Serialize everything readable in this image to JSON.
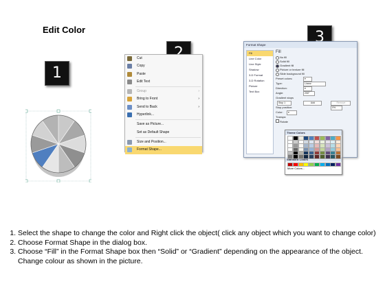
{
  "title": "Edit Color",
  "badges": [
    "1",
    "2",
    "3"
  ],
  "context_menu": {
    "items": [
      {
        "label": "Cut",
        "underline": "t",
        "icon": "scissors-icon",
        "color": "#7a6a3a",
        "disabled": false,
        "submenu": false
      },
      {
        "label": "Copy",
        "icon": "copy-icon",
        "color": "#6b7fa6",
        "disabled": false,
        "submenu": false
      },
      {
        "label": "Paste",
        "icon": "paste-icon",
        "color": "#b08a3a",
        "disabled": false,
        "submenu": false
      },
      {
        "label": "Edit Text",
        "icon": "edit-text-icon",
        "color": "#8a8a8a",
        "disabled": false,
        "submenu": false
      },
      {
        "label": "Group",
        "icon": "group-icon",
        "color": "#b5b5b5",
        "disabled": true,
        "submenu": true
      },
      {
        "label": "Bring to Front",
        "icon": "bring-front-icon",
        "color": "#d6a33a",
        "disabled": false,
        "submenu": true
      },
      {
        "label": "Send to Back",
        "icon": "send-back-icon",
        "color": "#6c8fc6",
        "disabled": false,
        "submenu": true
      },
      {
        "label": "Hyperlink...",
        "icon": "hyperlink-icon",
        "color": "#3a6fb0",
        "disabled": false,
        "submenu": false
      },
      {
        "label": "Save as Picture...",
        "icon": "",
        "color": "",
        "disabled": false,
        "submenu": false
      },
      {
        "label": "Set as Default Shape",
        "icon": "",
        "color": "",
        "disabled": false,
        "submenu": false
      },
      {
        "label": "Size and Position...",
        "icon": "size-position-icon",
        "color": "#8a9ab0",
        "disabled": false,
        "submenu": false
      },
      {
        "label": "Format Shape...",
        "icon": "format-shape-icon",
        "color": "#8ab0d0",
        "disabled": false,
        "submenu": false,
        "highlighted": true
      }
    ]
  },
  "dialog": {
    "title": "Format Shape",
    "side_items": [
      "Fill",
      "Line Color",
      "Line Style",
      "Shadow",
      "3-D Format",
      "3-D Rotation",
      "Picture",
      "Text Box"
    ],
    "selected_side": "Fill",
    "heading": "Fill",
    "fill_options": [
      "No fill",
      "Solid fill",
      "Gradient fill",
      "Picture or texture fill",
      "Slide background fill"
    ],
    "selected_fill": "Gradient fill",
    "fields": {
      "preset_colors": "Preset colors:",
      "type": "Type:",
      "type_value": "Linear",
      "direction": "Direction:",
      "angle": "Angle:",
      "angle_value": "290°",
      "gradient_stops": "Gradient stops",
      "stop": "Stop 1",
      "add": "Add",
      "remove": "Remove",
      "stop_position": "Stop position:",
      "stop_position_value": "0%",
      "color": "Color:",
      "transparency": "Transpa",
      "rotate": "Rotate"
    },
    "theme_colors_label": "Theme Colors",
    "standard_colors_label": "Standard Colors",
    "more_colors": "More Colors...",
    "theme_top": [
      "#ffffff",
      "#000000",
      "#eeece1",
      "#1f497d",
      "#4f81bd",
      "#c0504d",
      "#9bbb59",
      "#8064a2",
      "#4bacc6",
      "#f79646"
    ],
    "standard": [
      "#c00000",
      "#ff0000",
      "#ffc000",
      "#ffff00",
      "#92d050",
      "#00b050",
      "#00b0f0",
      "#0070c0",
      "#002060",
      "#7030a0"
    ]
  },
  "instructions": [
    "Select the shape to change the color and Right click the object( click any object which you want to change color)",
    "Choose Format Shape in the dialog box.",
    "Choose “Fill” in the Format Shape box then “Solid” or “Gradient” depending on the appearance of the object. Change colour as shown in the picture."
  ]
}
